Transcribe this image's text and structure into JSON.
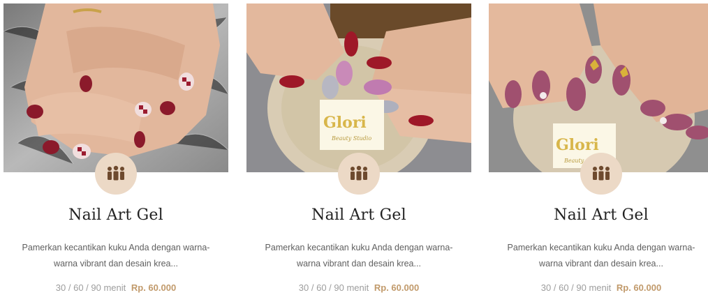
{
  "colors": {
    "accent": "#c19a6b",
    "badge_bg": "#ecd9c6",
    "title": "#222222",
    "text": "#5f5f5f",
    "muted": "#9d9d9d"
  },
  "cards": [
    {
      "icon": "people-group-icon",
      "title": "Nail Art Gel",
      "description": "Pamerkan kecantikan kuku Anda dengan warna-warna vibrant dan desain krea...",
      "duration": "30 / 60 / 90 menit",
      "price": "Rp. 60.000"
    },
    {
      "icon": "people-group-icon",
      "title": "Nail Art Gel",
      "description": "Pamerkan kecantikan kuku Anda dengan warna-warna vibrant dan desain krea...",
      "duration": "30 / 60 / 90 menit",
      "price": "Rp. 60.000",
      "photo_logo": "Glori",
      "photo_logo_sub": "Beauty Studio"
    },
    {
      "icon": "people-group-icon",
      "title": "Nail Art Gel",
      "description": "Pamerkan kecantikan kuku Anda dengan warna-warna vibrant dan desain krea...",
      "duration": "30 / 60 / 90 menit",
      "price": "Rp. 60.000",
      "photo_logo": "Glori",
      "photo_logo_sub": "Beauty Studio"
    }
  ]
}
